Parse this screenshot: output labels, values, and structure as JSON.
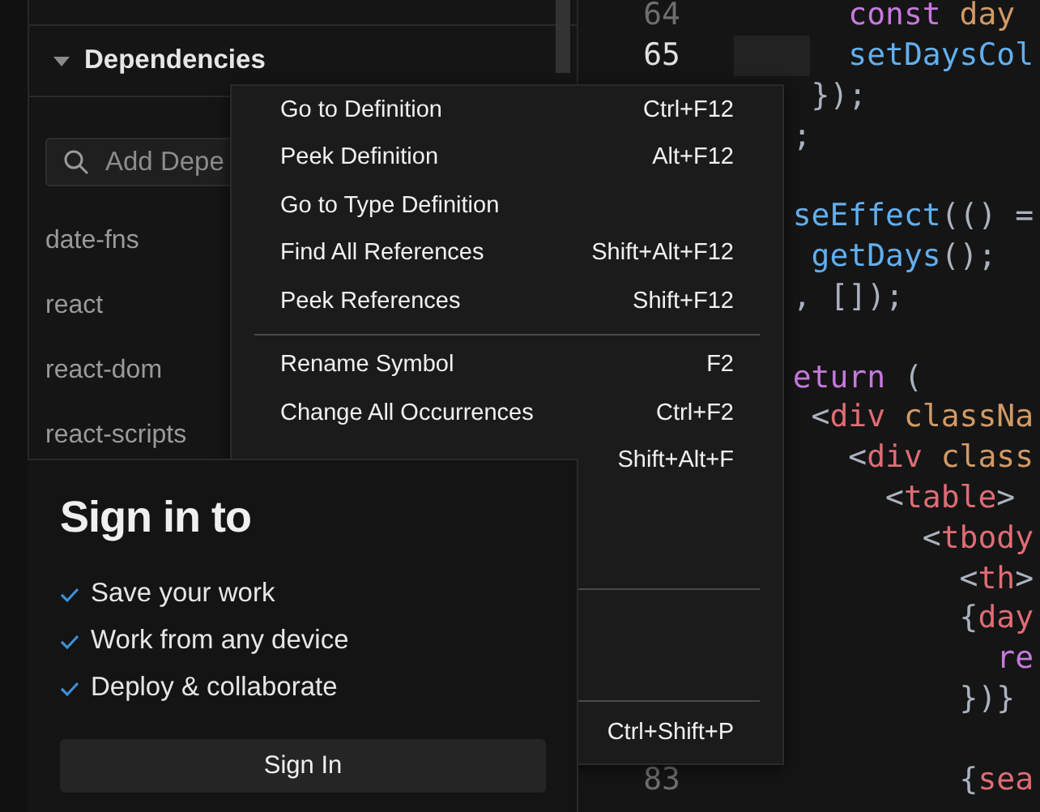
{
  "sidebar": {
    "section": {
      "title": "Dependencies",
      "expanded": true
    },
    "search": {
      "placeholder": "Add Depe"
    },
    "dependencies": [
      "date-fns",
      "react",
      "react-dom",
      "react-scripts"
    ]
  },
  "editor": {
    "lines": [
      {
        "number": "64",
        "current": false,
        "kind": "code",
        "tokens": [
          {
            "text": "      const ",
            "kind": "keyword"
          },
          {
            "text": "day",
            "kind": "variable"
          }
        ]
      },
      {
        "number": "65",
        "current": true,
        "kind": "code",
        "tokens": [
          {
            "text": "      setDaysCol",
            "kind": "function"
          }
        ]
      },
      {
        "kind": "code",
        "current": false,
        "tokens": [
          {
            "text": "    });",
            "kind": "punct"
          }
        ]
      },
      {
        "kind": "code",
        "current": false,
        "tokens": [
          {
            "text": "   ;",
            "kind": "punct"
          }
        ]
      },
      {
        "kind": "blank",
        "current": false
      },
      {
        "kind": "code",
        "current": false,
        "tokens": [
          {
            "text": "   seEffect",
            "kind": "function"
          },
          {
            "text": "(() =",
            "kind": "punct"
          }
        ]
      },
      {
        "kind": "code",
        "current": false,
        "tokens": [
          {
            "text": "    getDays",
            "kind": "function"
          },
          {
            "text": "();",
            "kind": "punct"
          }
        ]
      },
      {
        "kind": "code",
        "current": false,
        "tokens": [
          {
            "text": "   , []);",
            "kind": "punct"
          }
        ]
      },
      {
        "kind": "blank",
        "current": false
      },
      {
        "kind": "code",
        "current": false,
        "tokens": [
          {
            "text": "   eturn",
            "kind": "keyword"
          },
          {
            "text": " (",
            "kind": "punct"
          }
        ]
      },
      {
        "kind": "code",
        "current": false,
        "tokens": [
          {
            "text": "    <",
            "kind": "punct"
          },
          {
            "text": "div",
            "kind": "tag"
          },
          {
            "text": " classNa",
            "kind": "attribute"
          }
        ]
      },
      {
        "kind": "code",
        "current": false,
        "tokens": [
          {
            "text": "      <",
            "kind": "punct"
          },
          {
            "text": "div",
            "kind": "tag"
          },
          {
            "text": " class",
            "kind": "attribute"
          }
        ]
      },
      {
        "kind": "code",
        "current": false,
        "tokens": [
          {
            "text": "        <",
            "kind": "punct"
          },
          {
            "text": "table",
            "kind": "tag"
          },
          {
            "text": ">",
            "kind": "punct"
          }
        ]
      },
      {
        "kind": "code",
        "current": false,
        "tokens": [
          {
            "text": "          <",
            "kind": "punct"
          },
          {
            "text": "tbody",
            "kind": "tag"
          }
        ]
      },
      {
        "kind": "code",
        "current": false,
        "tokens": [
          {
            "text": "            <",
            "kind": "punct"
          },
          {
            "text": "th",
            "kind": "tag"
          },
          {
            "text": ">",
            "kind": "punct"
          }
        ]
      },
      {
        "kind": "code",
        "current": false,
        "tokens": [
          {
            "text": "            {",
            "kind": "punct"
          },
          {
            "text": "day",
            "kind": "tag"
          }
        ]
      },
      {
        "kind": "code",
        "current": false,
        "tokens": [
          {
            "text": "              re",
            "kind": "keyword"
          }
        ]
      },
      {
        "kind": "code",
        "current": false,
        "tokens": [
          {
            "text": "            })}",
            "kind": "punct"
          }
        ]
      },
      {
        "kind": "blank",
        "current": false
      },
      {
        "number": "83",
        "current": false,
        "kind": "code",
        "tokens": [
          {
            "text": "            {",
            "kind": "punct"
          },
          {
            "text": "sea",
            "kind": "tag"
          }
        ]
      }
    ]
  },
  "context_menu": {
    "groups": [
      [
        {
          "kind": "item",
          "label": "Go to Definition",
          "shortcut": "Ctrl+F12"
        },
        {
          "kind": "item",
          "label": "Peek Definition",
          "shortcut": "Alt+F12"
        },
        {
          "kind": "item",
          "label": "Go to Type Definition"
        },
        {
          "kind": "item",
          "label": "Find All References",
          "shortcut": "Shift+Alt+F12"
        },
        {
          "kind": "item",
          "label": "Peek References",
          "shortcut": "Shift+F12"
        }
      ],
      [
        {
          "kind": "item",
          "label": "Rename Symbol",
          "shortcut": "F2"
        },
        {
          "kind": "item",
          "label": "Change All Occurrences",
          "shortcut": "Ctrl+F2"
        },
        {
          "kind": "item",
          "shortcut": "Shift+Alt+F"
        },
        {
          "kind": "hidden"
        },
        {
          "kind": "hidden"
        }
      ],
      [
        {
          "kind": "hidden"
        },
        {
          "kind": "hidden"
        }
      ],
      [
        {
          "kind": "item",
          "shortcut": "Ctrl+Shift+P"
        }
      ]
    ]
  },
  "sign_in": {
    "title": "Sign in to",
    "benefits": [
      "Save your work",
      "Work from any device",
      "Deploy & collaborate"
    ],
    "button": "Sign In"
  }
}
